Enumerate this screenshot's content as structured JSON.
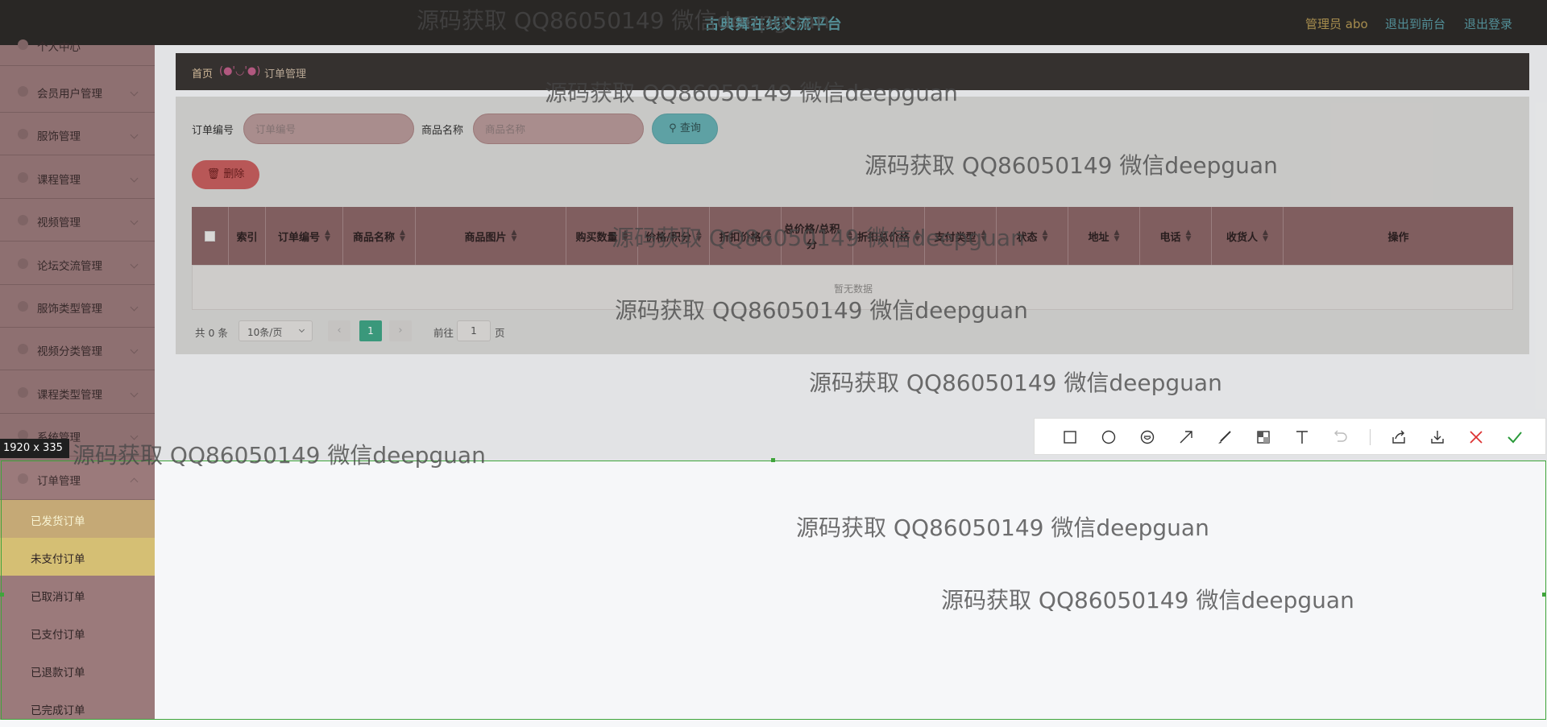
{
  "header": {
    "site_title": "古典舞在线交流平台",
    "admin_label": "管理员 abo",
    "to_front_label": "退出到前台",
    "logout_label": "退出登录"
  },
  "sidebar": {
    "items": [
      {
        "label": "个人中心"
      },
      {
        "label": "会员用户管理"
      },
      {
        "label": "服饰管理"
      },
      {
        "label": "课程管理"
      },
      {
        "label": "视频管理"
      },
      {
        "label": "论坛交流管理"
      },
      {
        "label": "服饰类型管理"
      },
      {
        "label": "视频分类管理"
      },
      {
        "label": "课程类型管理"
      },
      {
        "label": "系统管理"
      },
      {
        "label": "订单管理"
      }
    ],
    "sub_items": [
      {
        "label": "已发货订单"
      },
      {
        "label": "未支付订单"
      },
      {
        "label": "已取消订单"
      },
      {
        "label": "已支付订单"
      },
      {
        "label": "已退款订单"
      },
      {
        "label": "已完成订单"
      }
    ]
  },
  "breadcrumb": {
    "home": "首页",
    "separator": "(●'◡'●)",
    "current": "订单管理"
  },
  "search": {
    "order_no_label": "订单编号",
    "order_no_placeholder": "订单编号",
    "product_name_label": "商品名称",
    "product_name_placeholder": "商品名称",
    "query_button": "查询"
  },
  "actions": {
    "delete_button": "删除"
  },
  "table": {
    "columns": [
      "索引",
      "订单编号",
      "商品名称",
      "商品图片",
      "购买数量",
      "价格/积分",
      "折扣价格",
      "总价格/总积分",
      "折扣总价格",
      "支付类型",
      "状态",
      "地址",
      "电话",
      "收货人",
      "操作"
    ],
    "empty_text": "暂无数据"
  },
  "pagination": {
    "total": "共 0 条",
    "page_size": "10条/页",
    "current_page": "1",
    "goto_label": "前往",
    "goto_value": "1",
    "page_suffix": "页",
    "prev": "‹",
    "next": "›"
  },
  "screenshot_tool": {
    "size_label": "1920 x 335",
    "tools": [
      "rectangle-icon",
      "ellipse-icon",
      "emoji-icon",
      "arrow-icon",
      "brush-icon",
      "mosaic-icon",
      "text-icon",
      "undo-icon",
      "share-icon",
      "download-icon",
      "close-icon",
      "confirm-icon"
    ]
  },
  "watermark": {
    "text": "源码获取 QQ86050149 微信deepguan"
  }
}
